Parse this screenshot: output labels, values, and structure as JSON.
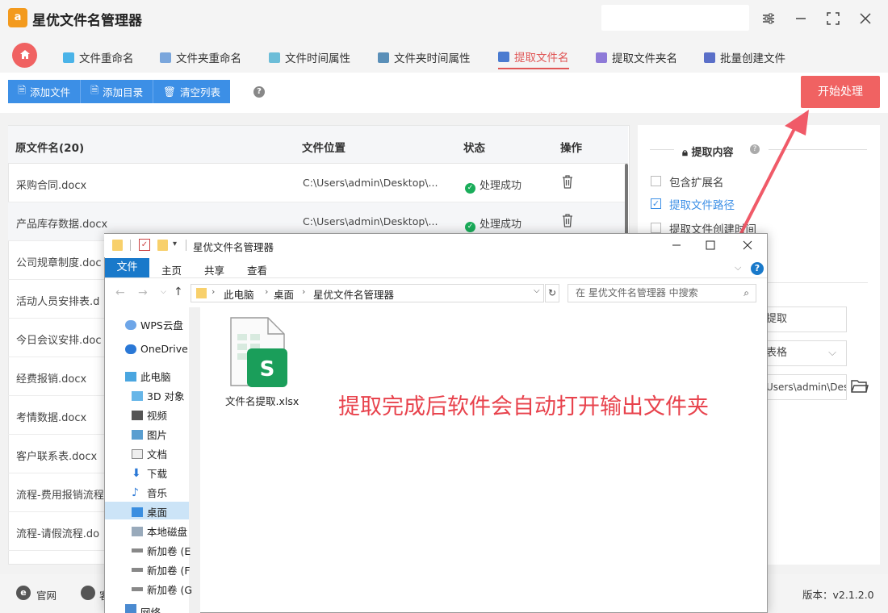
{
  "app": {
    "logo_text": "a",
    "title": "星优文件名管理器"
  },
  "tabs": [
    {
      "label": "文件重命名"
    },
    {
      "label": "文件夹重命名"
    },
    {
      "label": "文件时间属性"
    },
    {
      "label": "文件夹时间属性"
    },
    {
      "label": "提取文件名",
      "active": true
    },
    {
      "label": "提取文件夹名"
    },
    {
      "label": "批量创建文件"
    }
  ],
  "toolbar": {
    "add_file": "添加文件",
    "add_dir": "添加目录",
    "clear_list": "清空列表",
    "help": "?",
    "start": "开始处理"
  },
  "table": {
    "headers": [
      "原文件名(20)",
      "文件位置",
      "状态",
      "操作"
    ],
    "rows": [
      {
        "name": "采购合同.docx",
        "path": "C:\\Users\\admin\\Desktop\\...",
        "status": "处理成功"
      },
      {
        "name": "产品库存数据.docx",
        "path": "C:\\Users\\admin\\Desktop\\...",
        "status": "处理成功"
      },
      {
        "name": "公司规章制度.doc",
        "path": "",
        "status": ""
      },
      {
        "name": "活动人员安排表.d",
        "path": "",
        "status": ""
      },
      {
        "name": "今日会议安排.doc",
        "path": "",
        "status": ""
      },
      {
        "name": "经费报销.docx",
        "path": "",
        "status": ""
      },
      {
        "name": "考情数据.docx",
        "path": "",
        "status": ""
      },
      {
        "name": "客户联系表.docx",
        "path": "",
        "status": ""
      },
      {
        "name": "流程-费用报销流程",
        "path": "",
        "status": ""
      },
      {
        "name": "流程-请假流程.do",
        "path": "",
        "status": ""
      }
    ]
  },
  "right_panel": {
    "title": "提取内容",
    "options": [
      {
        "label": "包含扩展名",
        "checked": false
      },
      {
        "label": "提取文件路径",
        "checked": true
      },
      {
        "label": "提取文件创建时间",
        "checked": false
      }
    ],
    "partial_1": "提取",
    "partial_2": "表格",
    "partial_path": "Users\\admin\\Des"
  },
  "statusbar": {
    "website": "官网",
    "partial": "客",
    "version": "版本：v2.1.2.0"
  },
  "explorer": {
    "title": "星优文件名管理器",
    "ribbon_tabs": [
      "文件",
      "主页",
      "共享",
      "查看"
    ],
    "breadcrumb": [
      "此电脑",
      "桌面",
      "星优文件名管理器"
    ],
    "search_placeholder": "在 星优文件名管理器 中搜索",
    "nav_items": [
      "WPS云盘",
      "OneDrive",
      "此电脑",
      "3D 对象",
      "视频",
      "图片",
      "文档",
      "下载",
      "音乐",
      "桌面",
      "本地磁盘",
      "新加卷 (E",
      "新加卷 (F",
      "新加卷 (G",
      "网络"
    ],
    "file": {
      "name": "文件名提取.xlsx",
      "badge": "S"
    }
  },
  "annotation": "提取完成后软件会自动打开输出文件夹",
  "colors": {
    "accent_red": "#f06262",
    "primary_blue": "#3c8fe6",
    "success_green": "#1aad5a",
    "annotation_red": "#e8434d",
    "explorer_blue": "#1979ca"
  }
}
